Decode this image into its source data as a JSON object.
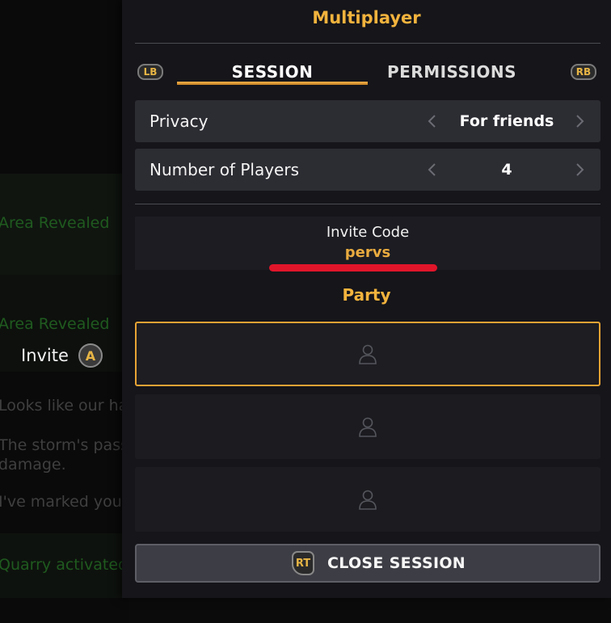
{
  "background": {
    "messages": [
      "Area Revealed",
      "Area Revealed",
      "Looks like our ha",
      "The storm's pass",
      "damage.",
      "I've marked your",
      "Quarry activated"
    ],
    "invite_label": "Invite",
    "invite_button_glyph": "A"
  },
  "panel": {
    "title": "Multiplayer",
    "bumper_left": "LB",
    "bumper_right": "RB",
    "tabs": [
      {
        "label": "SESSION",
        "active": true
      },
      {
        "label": "PERMISSIONS",
        "active": false
      }
    ],
    "settings": [
      {
        "label": "Privacy",
        "value": "For friends"
      },
      {
        "label": "Number of Players",
        "value": "4"
      }
    ],
    "invite_code_label": "Invite Code",
    "invite_code_value": "pervs",
    "party_title": "Party",
    "party_slots": [
      {
        "icon": "person-icon",
        "selected": true
      },
      {
        "icon": "person-icon",
        "selected": false
      },
      {
        "icon": "person-icon",
        "selected": false
      }
    ],
    "close_button": {
      "glyph": "RT",
      "label": "CLOSE SESSION"
    }
  },
  "colors": {
    "accent": "#f2b33d",
    "panel_bg": "#15151a",
    "row_bg": "#2c2c33",
    "selected_border": "#e8a334",
    "annotation_red": "#e0152a"
  }
}
